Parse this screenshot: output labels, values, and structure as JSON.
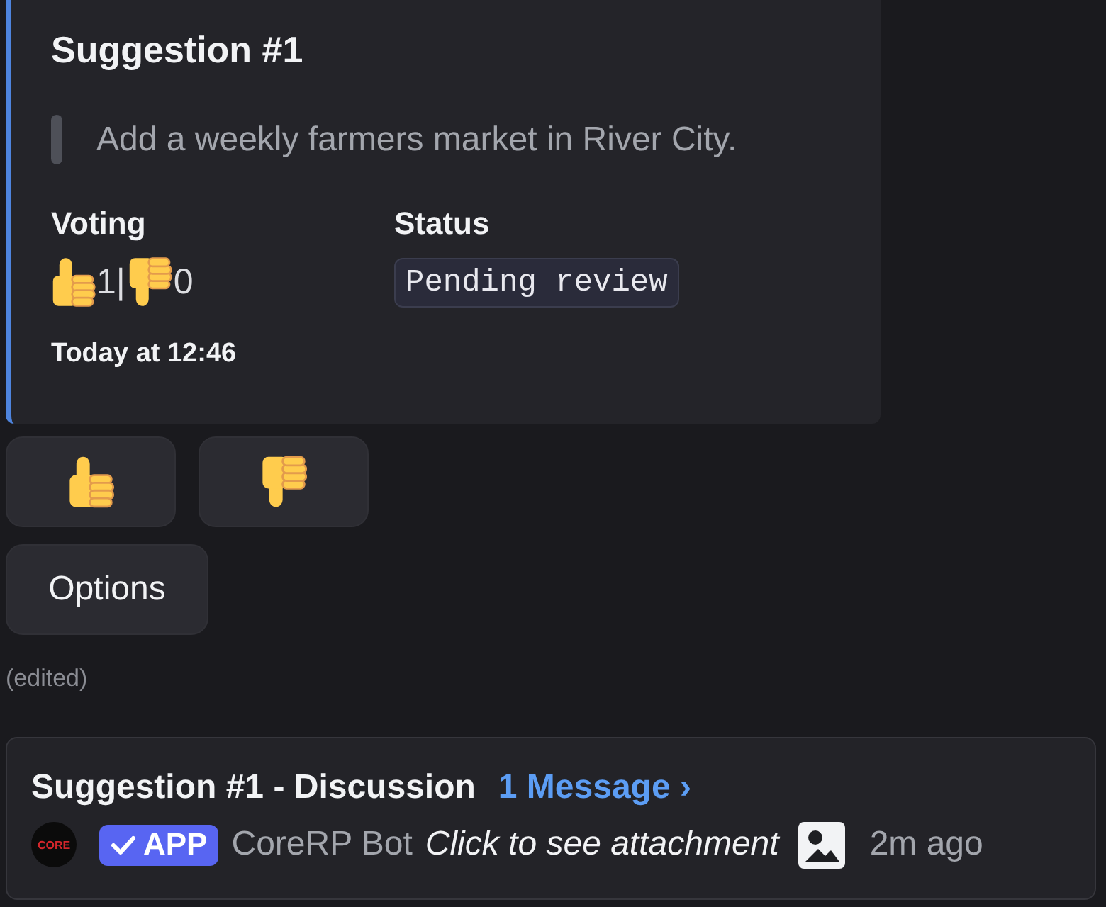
{
  "embed": {
    "title": "Suggestion #1",
    "quote": "Add a weekly farmers market in River City.",
    "fields": [
      {
        "kind": "votes",
        "name": "Voting",
        "up_count": "1",
        "separator": "|",
        "down_count": "0"
      },
      {
        "kind": "code",
        "name": "Status",
        "value": "Pending review"
      }
    ],
    "timestamp": "Today at 12:46"
  },
  "action_rows": [
    {
      "buttons": [
        {
          "kind": "upvote"
        },
        {
          "kind": "downvote"
        }
      ]
    },
    {
      "buttons": [
        {
          "kind": "text",
          "label": "Options"
        }
      ]
    }
  ],
  "edited": "(edited)",
  "thread": {
    "title": "Suggestion #1 - Discussion",
    "link": "1 Message ›",
    "avatar_text": "CORE",
    "badge": "APP",
    "author": "CoreRP Bot",
    "preview": "Click to see attachment",
    "time": "2m ago"
  }
}
